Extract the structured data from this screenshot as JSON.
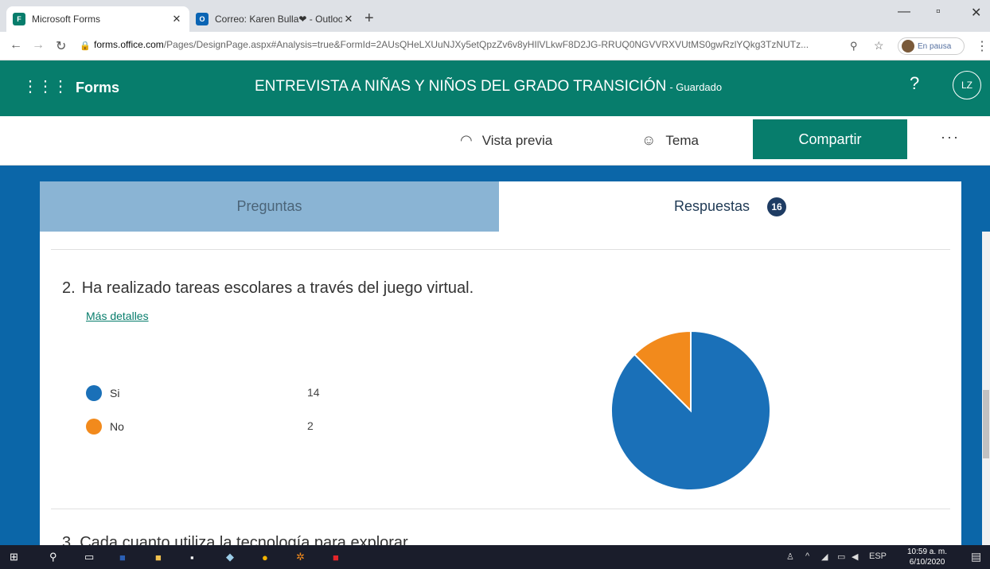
{
  "browser": {
    "tabs": [
      {
        "title": "Microsoft Forms",
        "icon": "forms-icon"
      },
      {
        "title": "Correo: Karen Bulla❤ - Outlook",
        "icon": "outlook-icon"
      }
    ],
    "url_host": "forms.office.com",
    "url_path": "/Pages/DesignPage.aspx#Analysis=true&FormId=2AUsQHeLXUuNJXy5etQpzZv6v8yHIlVLkwF8D2JG-RRUQ0NGVVRXVUtMS0gwRzlYQkg3TzNUTz...",
    "profile_status": "En pausa"
  },
  "header": {
    "brand": "Forms",
    "form_title": "ENTREVISTA A NIÑAS Y NIÑOS DEL GRADO TRANSICIÓN",
    "save_status": "- Guardado",
    "help": "?",
    "user_initials": "LZ",
    "accent_color": "#077d6c"
  },
  "commandbar": {
    "preview": "Vista previa",
    "theme": "Tema",
    "share": "Compartir",
    "more": "···"
  },
  "tabs": {
    "questions": "Preguntas",
    "responses": "Respuestas",
    "response_count": "16"
  },
  "question": {
    "number": "2.",
    "text": "Ha realizado tareas escolares a través del juego virtual.",
    "more_details": "Más detalles",
    "options": [
      {
        "label": "Si",
        "count": "14",
        "color": "#1a70b8"
      },
      {
        "label": "No",
        "count": "2",
        "color": "#f28a1c"
      }
    ],
    "next_title_partial": "3.   Cada cuanto utiliza la tecnología para explorar..."
  },
  "chart_data": {
    "type": "pie",
    "categories": [
      "Si",
      "No"
    ],
    "values": [
      14,
      2
    ],
    "colors": [
      "#1a70b8",
      "#f28a1c"
    ]
  },
  "taskbar": {
    "lang": "ESP",
    "time": "10:59 a. m.",
    "date": "6/10/2020"
  }
}
